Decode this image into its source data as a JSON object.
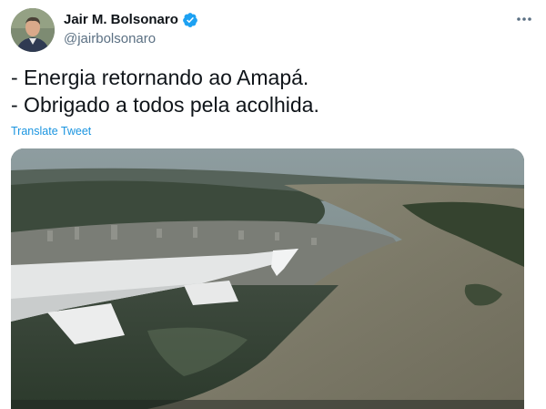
{
  "tweet": {
    "display_name": "Jair M. Bolsonaro",
    "handle": "@jairbolsonaro",
    "verified": true,
    "text": "- Energia retornando ao Amapá.\n- Obrigado a todos pela acolhida.",
    "translate_label": "Translate Tweet"
  },
  "icons": {
    "verified": "verified-badge-icon",
    "more": "more-options-icon"
  },
  "colors": {
    "link": "#1b95e0",
    "verified": "#1da1f2",
    "secondary_text": "#5b7083"
  }
}
